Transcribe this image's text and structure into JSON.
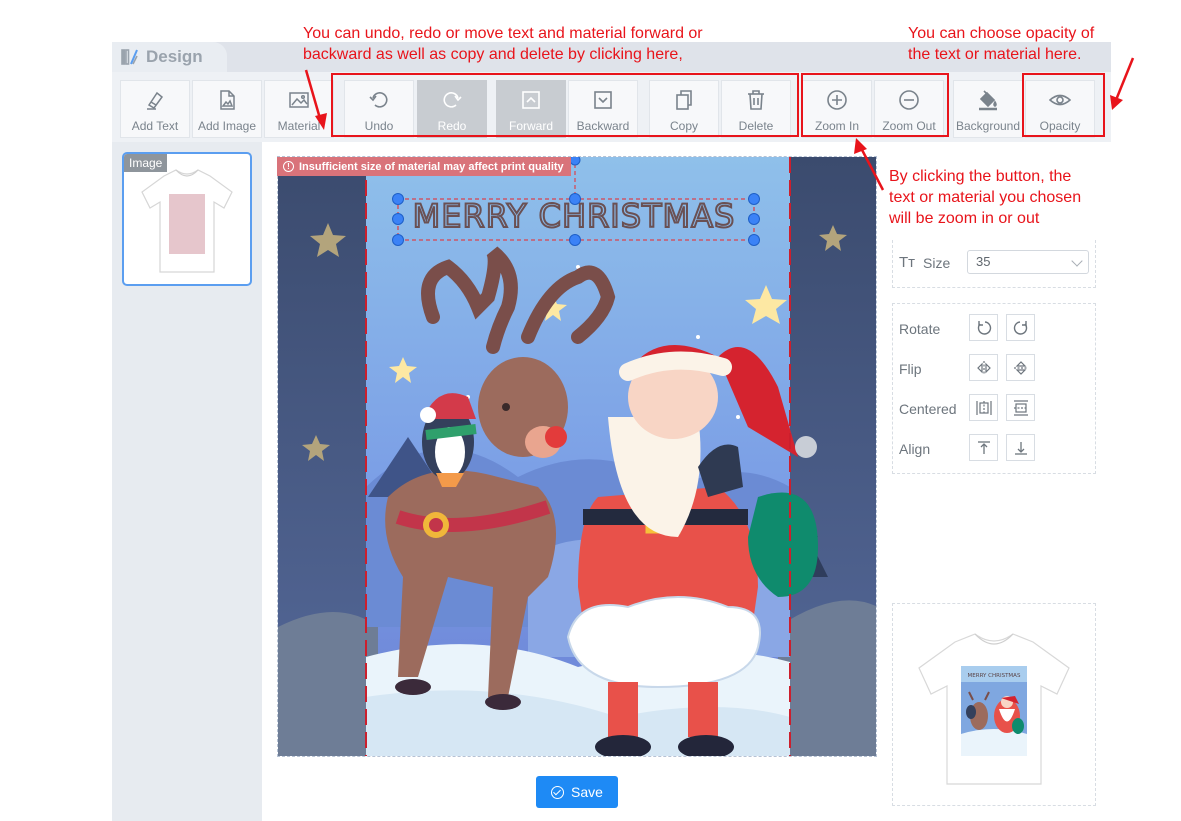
{
  "tab": {
    "title": "Design"
  },
  "toolbar": {
    "add_text": "Add Text",
    "add_image": "Add Image",
    "material": "Material",
    "undo": "Undo",
    "redo": "Redo",
    "forward": "Forward",
    "backward": "Backward",
    "copy": "Copy",
    "delete": "Delete",
    "zoom_in": "Zoom In",
    "zoom_out": "Zoom Out",
    "background": "Background",
    "opacity": "Opacity"
  },
  "annotations": {
    "toolbar_note_line1": "You can undo, redo or move text and material forward or",
    "toolbar_note_line2": "backward as well as copy and delete by clicking here,",
    "opacity_note_line1": "You can choose opacity of",
    "opacity_note_line2": "the text or material here.",
    "zoom_note_line1": "By clicking the button, the",
    "zoom_note_line2": "text or material you chosen",
    "zoom_note_line3": "will be  zoom in or out"
  },
  "thumbnail": {
    "label": "Image"
  },
  "canvas": {
    "warning": "Insufficient size of material may affect print quality",
    "text_layer": "MERRY CHRISTMAS"
  },
  "actions": {
    "save": "Save"
  },
  "properties": {
    "size_label": "Size",
    "size_icon": "Tт",
    "size_value": "35",
    "rotate_label": "Rotate",
    "flip_label": "Flip",
    "centered_label": "Centered",
    "align_label": "Align"
  },
  "preview": {
    "shirt_text": "MERRY CHRISTMAS"
  },
  "colors": {
    "accent": "#1e8af5",
    "annotation": "#e8141b",
    "handle": "#3b82f6",
    "warning": "#d9737a"
  }
}
